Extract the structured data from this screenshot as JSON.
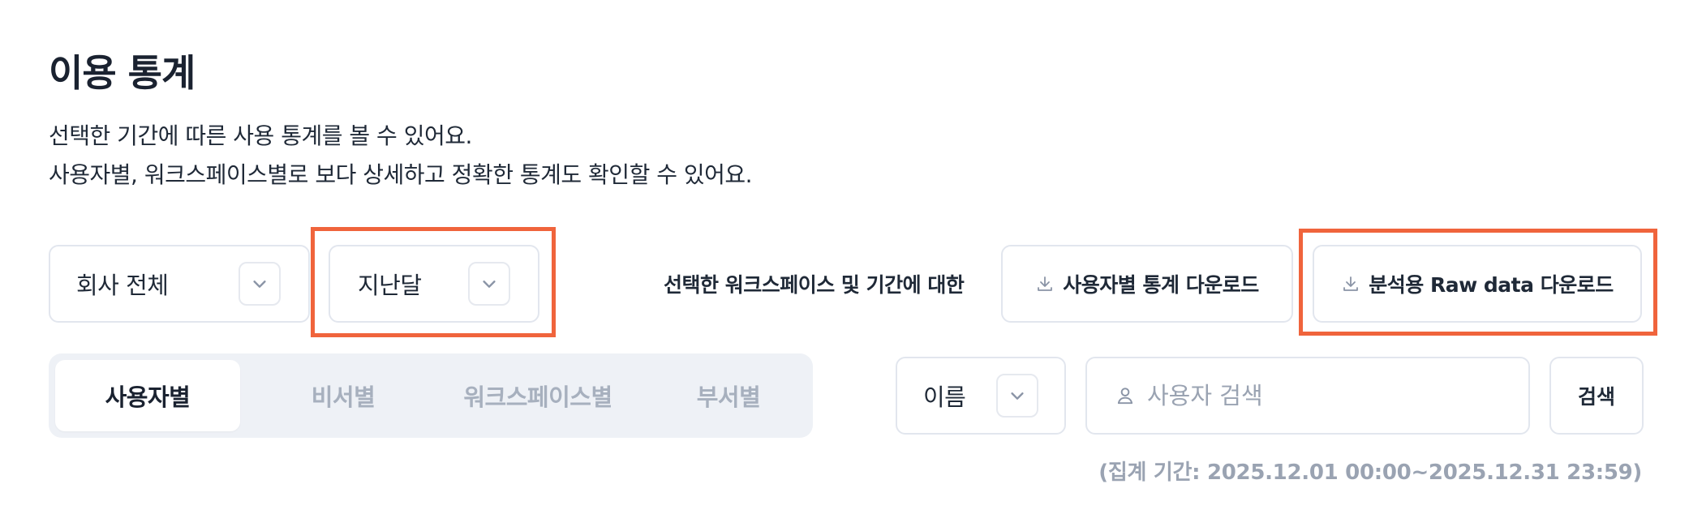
{
  "header": {
    "title": "이용 통계",
    "description_line1": "선택한 기간에 따른 사용 통계를 볼 수 있어요.",
    "description_line2": "사용자별, 워크스페이스별로 보다 상세하고 정확한 통계도 확인할 수 있어요."
  },
  "filters": {
    "scope_selected": "회사 전체",
    "period_selected": "지난달"
  },
  "download": {
    "prefix_label": "선택한 워크스페이스 및 기간에 대한",
    "user_stats_label": "사용자별 통계 다운로드",
    "raw_data_label": "분석용 Raw data 다운로드"
  },
  "tabs": [
    {
      "label": "사용자별",
      "active": true
    },
    {
      "label": "비서별",
      "active": false
    },
    {
      "label": "워크스페이스별",
      "active": false
    },
    {
      "label": "부서별",
      "active": false
    }
  ],
  "search": {
    "field_selected": "이름",
    "placeholder": "사용자 검색",
    "button_label": "검색"
  },
  "period_note": "(집계 기간: 2025.12.01 00:00~2025.12.31 23:59)",
  "colors": {
    "highlight": "#f0643c",
    "muted_text": "#9aa3b2",
    "tab_bg": "#eef1f6"
  },
  "icons": {
    "chevron": "chevron-down-icon",
    "download": "download-icon",
    "user": "user-icon"
  }
}
